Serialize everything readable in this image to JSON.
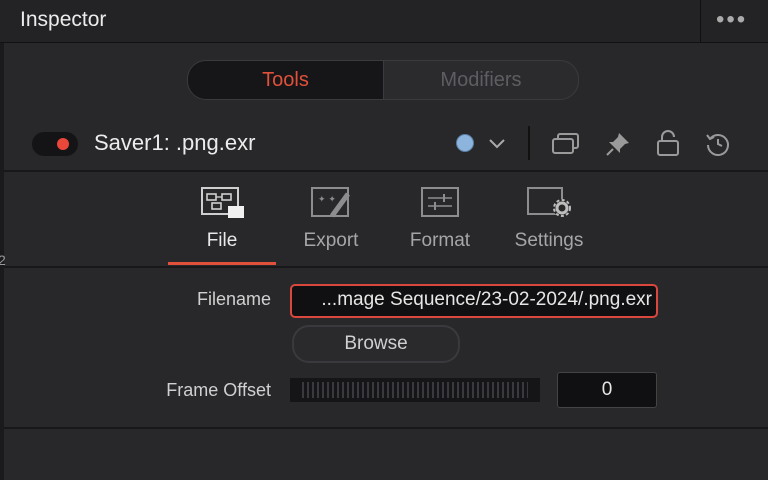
{
  "header": {
    "title": "Inspector",
    "menu_icon": "ellipsis-icon"
  },
  "segmented": {
    "tools_label": "Tools",
    "modifiers_label": "Modifiers",
    "active": "Tools",
    "accent": "#e0503a"
  },
  "tool": {
    "name": "Saver1: .png.exr",
    "enabled": true,
    "enabled_color": "#e9473a",
    "color_swatch": "#8cb4dc"
  },
  "toolbar_icons": [
    "chevron-down-icon",
    "versions-icon",
    "pin-icon",
    "lock-icon",
    "reset-icon"
  ],
  "tabs": [
    {
      "label": "File",
      "icon": "file-node-icon",
      "active": true
    },
    {
      "label": "Export",
      "icon": "export-wand-icon",
      "active": false
    },
    {
      "label": "Format",
      "icon": "format-sliders-icon",
      "active": false
    },
    {
      "label": "Settings",
      "icon": "settings-gear-icon",
      "active": false
    }
  ],
  "form": {
    "filename_label": "Filename",
    "filename_value": "...mage Sequence/23-02-2024/.png.exr",
    "browse_label": "Browse",
    "frame_offset_label": "Frame Offset",
    "frame_offset_value": "0"
  }
}
